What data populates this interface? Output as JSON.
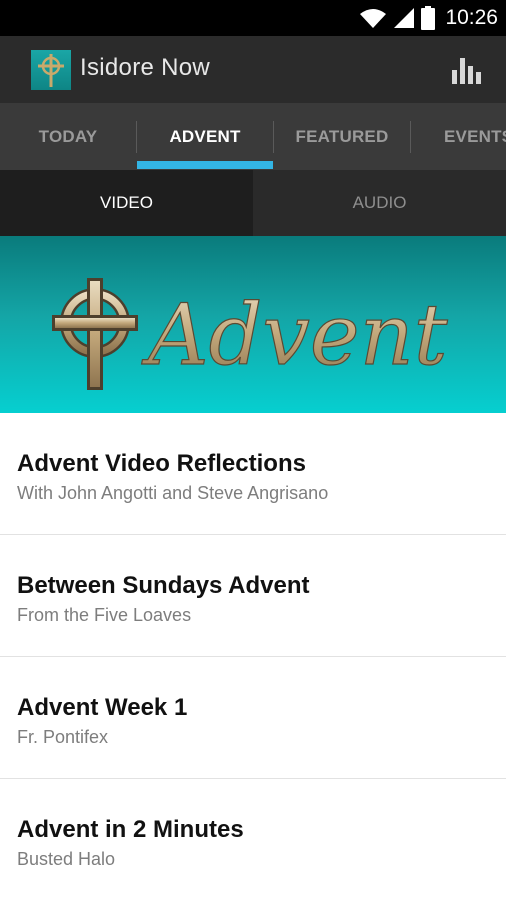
{
  "status_bar": {
    "time": "10:26",
    "icons": [
      "wifi-icon",
      "cell-signal-icon",
      "battery-icon"
    ]
  },
  "app": {
    "title": "Isidore Now",
    "icon": "celtic-cross-app-icon",
    "action_icon": "bar-chart-icon"
  },
  "tabs": [
    {
      "label": "TODAY",
      "active": false
    },
    {
      "label": "ADVENT",
      "active": true
    },
    {
      "label": "FEATURED",
      "active": false
    },
    {
      "label": "EVENTS",
      "active": false
    }
  ],
  "subtabs": [
    {
      "label": "VIDEO",
      "active": true
    },
    {
      "label": "AUDIO",
      "active": false
    }
  ],
  "banner": {
    "script_text": "Advent",
    "icon": "celtic-cross-icon"
  },
  "items": [
    {
      "title": "Advent Video Reflections",
      "subtitle": "With John Angotti and Steve Angrisano"
    },
    {
      "title": "Between Sundays Advent",
      "subtitle": "From the Five Loaves"
    },
    {
      "title": "Advent Week 1",
      "subtitle": "Fr. Pontifex"
    },
    {
      "title": "Advent in 2 Minutes",
      "subtitle": "Busted Halo"
    }
  ],
  "colors": {
    "accent": "#33b5e5",
    "action_bar": "#2b2b2b",
    "tab_bar": "#3a3a3a",
    "banner_top": "#0a7b7c",
    "banner_bottom": "#06cfd0"
  }
}
